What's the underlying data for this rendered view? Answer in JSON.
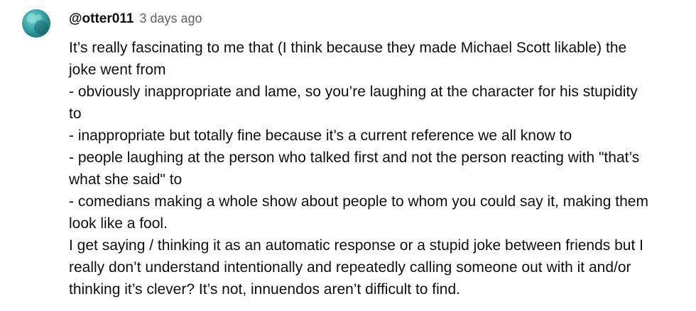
{
  "comment": {
    "author": "@otter011",
    "timestamp": "3 days ago",
    "avatar_icon": "avatar-icon",
    "lines": [
      "It’s really fascinating to me that (I think because they made Michael Scott likable) the",
      "joke went from",
      "- obviously inappropriate and lame, so you’re laughing at the character for his stupidity",
      "to",
      "- inappropriate but totally fine because it’s a current reference we all know to",
      "- people laughing at the person who talked first and not the person reacting with \"that’s",
      "what she said\" to",
      "- comedians making a whole show about people to whom you could say it, making them",
      "look like a fool.",
      "I get saying / thinking it as an automatic response or a stupid joke between friends but I",
      "really don’t understand intentionally and repeatedly calling someone out with it and/or",
      "thinking it’s clever? It’s not, innuendos aren’t difficult to find."
    ]
  }
}
